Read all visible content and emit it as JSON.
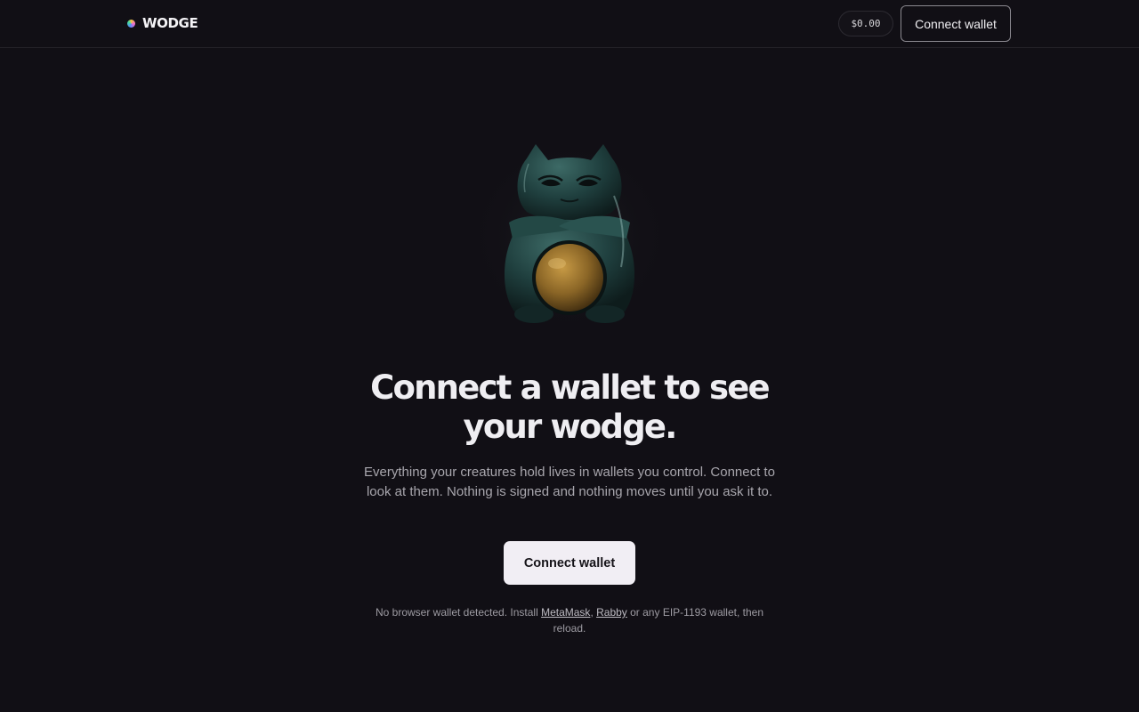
{
  "header": {
    "brand_name": "WODGE",
    "balance": "$0.00",
    "connect_label": "Connect wallet"
  },
  "hero": {
    "image": "jade frog-cat creature figurine holding a gold orb",
    "headline": "Connect a wallet to see your wodge.",
    "subtext": "Everything your creatures hold lives in wallets you control. Connect to look at them. Nothing is signed and nothing moves until you ask it to.",
    "connect_label": "Connect wallet"
  },
  "note": {
    "prefix": "No browser wallet detected. Install ",
    "link_metamask": "MetaMask",
    "sep": ", ",
    "link_rabby": "Rabby",
    "suffix": " or any EIP-1193 wallet, then reload."
  },
  "colors": {
    "background": "#110f15",
    "primary_button": "#f1eef4",
    "text": "#efeef2",
    "muted_text": "#a8a6ad"
  }
}
